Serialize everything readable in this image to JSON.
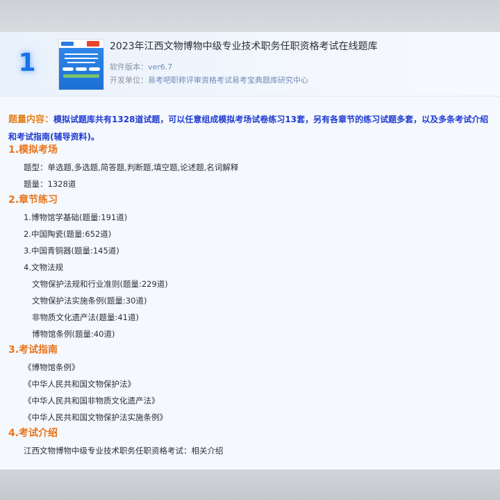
{
  "header": {
    "number": "1",
    "title": "2023年江西文物博物中级专业技术职务任职资格考试在线题库",
    "version_label": "软件版本：",
    "version_value": "ver6.7",
    "developer_label": "开发单位：",
    "developer_value": "易考吧职称评审资格考试易考宝典题库研究中心"
  },
  "intro": {
    "label": "题量内容：",
    "text": "模拟试题库共有1328道试题，可以任意组成模拟考场试卷练习13套，另有各章节的练习试题多套，以及多条考试介绍和考试指南(辅导资料)。"
  },
  "sections": {
    "mock_exam": {
      "heading": "1.模拟考场",
      "types": "题型：单选题,多选题,简答题,判断题,填空题,论述题,名词解释",
      "count": "题量：1328道"
    },
    "chapters": {
      "heading": "2.章节练习",
      "items": [
        "1.博物馆学基础(题量:191道)",
        "2.中国陶瓷(题量:652道)",
        "3.中国青铜器(题量:145道)",
        "4.文物法规"
      ],
      "sub_items": [
        "文物保护法规和行业准则(题量:229道)",
        "文物保护法实施条例(题量:30道)",
        "非物质文化遗产法(题量:41道)",
        "博物馆条例(题量:40道)"
      ]
    },
    "guide": {
      "heading": "3.考试指南",
      "items": [
        "《博物馆条例》",
        "《中华人民共和国文物保护法》",
        "《中华人民共和国非物质文化遗产法》",
        "《中华人民共和国文物保护法实施条例》"
      ]
    },
    "intro_exam": {
      "heading": "4.考试介绍",
      "text": "江西文物博物中级专业技术职务任职资格考试：相关介绍"
    }
  },
  "colors": {
    "accent_blue": "#1a72e8",
    "heading_orange": "#e8741c",
    "intro_blue": "#1f3bd1"
  }
}
